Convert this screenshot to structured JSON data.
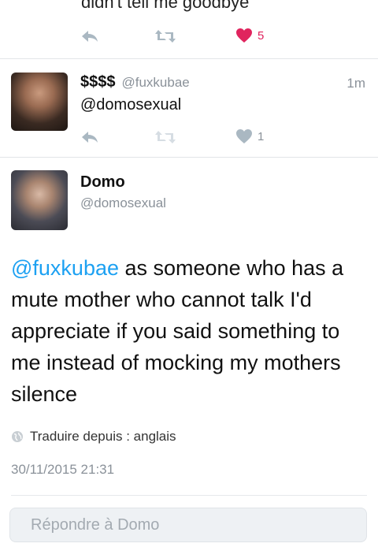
{
  "tweet_prev": {
    "text_partial": "didn't tell me goodbye",
    "likes": "5"
  },
  "tweet_reply": {
    "name": "$$$$",
    "handle": "@fuxkubae",
    "time": "1m",
    "text": "@domosexual",
    "likes": "1"
  },
  "main_tweet": {
    "name": "Domo",
    "handle": "@domosexual",
    "mention": "@fuxkubae",
    "text": " as someone who has a mute mother who cannot talk I'd appreciate if you said something to me instead of mocking my mothers silence",
    "translate_label": "Traduire depuis : anglais",
    "date": "30/11/2015 21:31"
  },
  "reply_box": {
    "placeholder": "Répondre à Domo"
  },
  "colors": {
    "like_active": "#e0245e",
    "accent": "#1da1f2",
    "icon_gray": "#aab8c2"
  },
  "icons": [
    "reply-icon",
    "retweet-icon",
    "heart-icon",
    "globe-icon"
  ]
}
